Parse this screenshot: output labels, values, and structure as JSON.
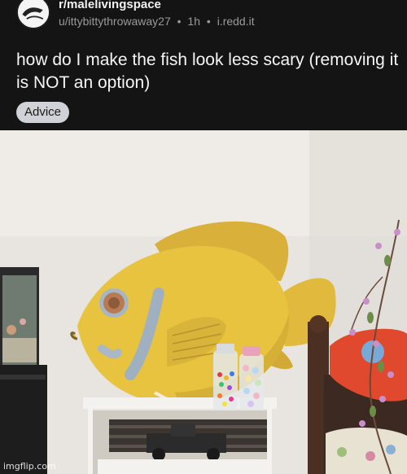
{
  "post": {
    "subreddit": "r/malelivingspace",
    "author": "u/ittybittythrowaway27",
    "separator": "•",
    "age": "1h",
    "domain": "i.redd.it",
    "title": "how do I make the fish look less scary (removing it is NOT an option)",
    "flair": "Advice"
  },
  "image": {
    "watermark": "imgflip.com"
  },
  "colors": {
    "header_bg": "#141414",
    "flair_bg": "#cfd2d6",
    "fish_yellow": "#e6c43f",
    "wall": "#e9e6e1"
  },
  "icons": {
    "avatar": "subreddit-avatar-icon"
  }
}
